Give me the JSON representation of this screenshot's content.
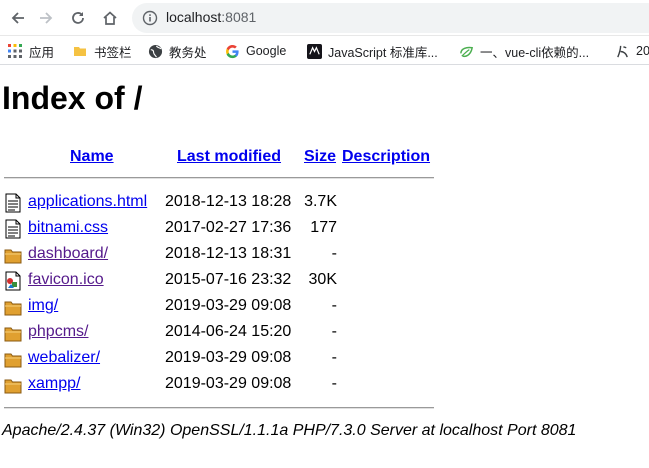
{
  "browser": {
    "url_host": "localhost",
    "url_port": ":8081"
  },
  "bookmarks": [
    {
      "label": "应用",
      "icon": "apps-grid-icon"
    },
    {
      "label": "书签栏",
      "icon": "folder-icon"
    },
    {
      "label": "教务处",
      "icon": "globe-icon"
    },
    {
      "label": "Google",
      "icon": "google-icon"
    },
    {
      "label": "JavaScript 标准库...",
      "icon": "mdn-icon"
    },
    {
      "label": "一、vue-cli依赖的...",
      "icon": "leaf-icon"
    },
    {
      "label": "20",
      "icon": "site-icon"
    }
  ],
  "page": {
    "title": "Index of /",
    "columns": {
      "name": "Name",
      "last_modified": "Last modified",
      "size": "Size",
      "description": "Description"
    },
    "entries": [
      {
        "name": "applications.html",
        "modified": "2018-12-13 18:28",
        "size": "3.7K",
        "icon": "text-file-icon",
        "visited": false
      },
      {
        "name": "bitnami.css",
        "modified": "2017-02-27 17:36",
        "size": "177",
        "icon": "text-file-icon",
        "visited": false
      },
      {
        "name": "dashboard/",
        "modified": "2018-12-13 18:31",
        "size": "-",
        "icon": "folder-icon",
        "visited": true
      },
      {
        "name": "favicon.ico",
        "modified": "2015-07-16 23:32",
        "size": "30K",
        "icon": "image-file-icon",
        "visited": true
      },
      {
        "name": "img/",
        "modified": "2019-03-29 09:08",
        "size": "-",
        "icon": "folder-icon",
        "visited": false
      },
      {
        "name": "phpcms/",
        "modified": "2014-06-24 15:20",
        "size": "-",
        "icon": "folder-icon",
        "visited": true
      },
      {
        "name": "webalizer/",
        "modified": "2019-03-29 09:08",
        "size": "-",
        "icon": "folder-icon",
        "visited": false
      },
      {
        "name": "xampp/",
        "modified": "2019-03-29 09:08",
        "size": "-",
        "icon": "folder-icon",
        "visited": false
      }
    ],
    "footer": "Apache/2.4.37 (Win32) OpenSSL/1.1.1a PHP/7.3.0 Server at localhost Port 8081"
  },
  "colors": {
    "link": "#0000ee",
    "visited_link": "#551a8b",
    "folder": "#e0a030"
  }
}
